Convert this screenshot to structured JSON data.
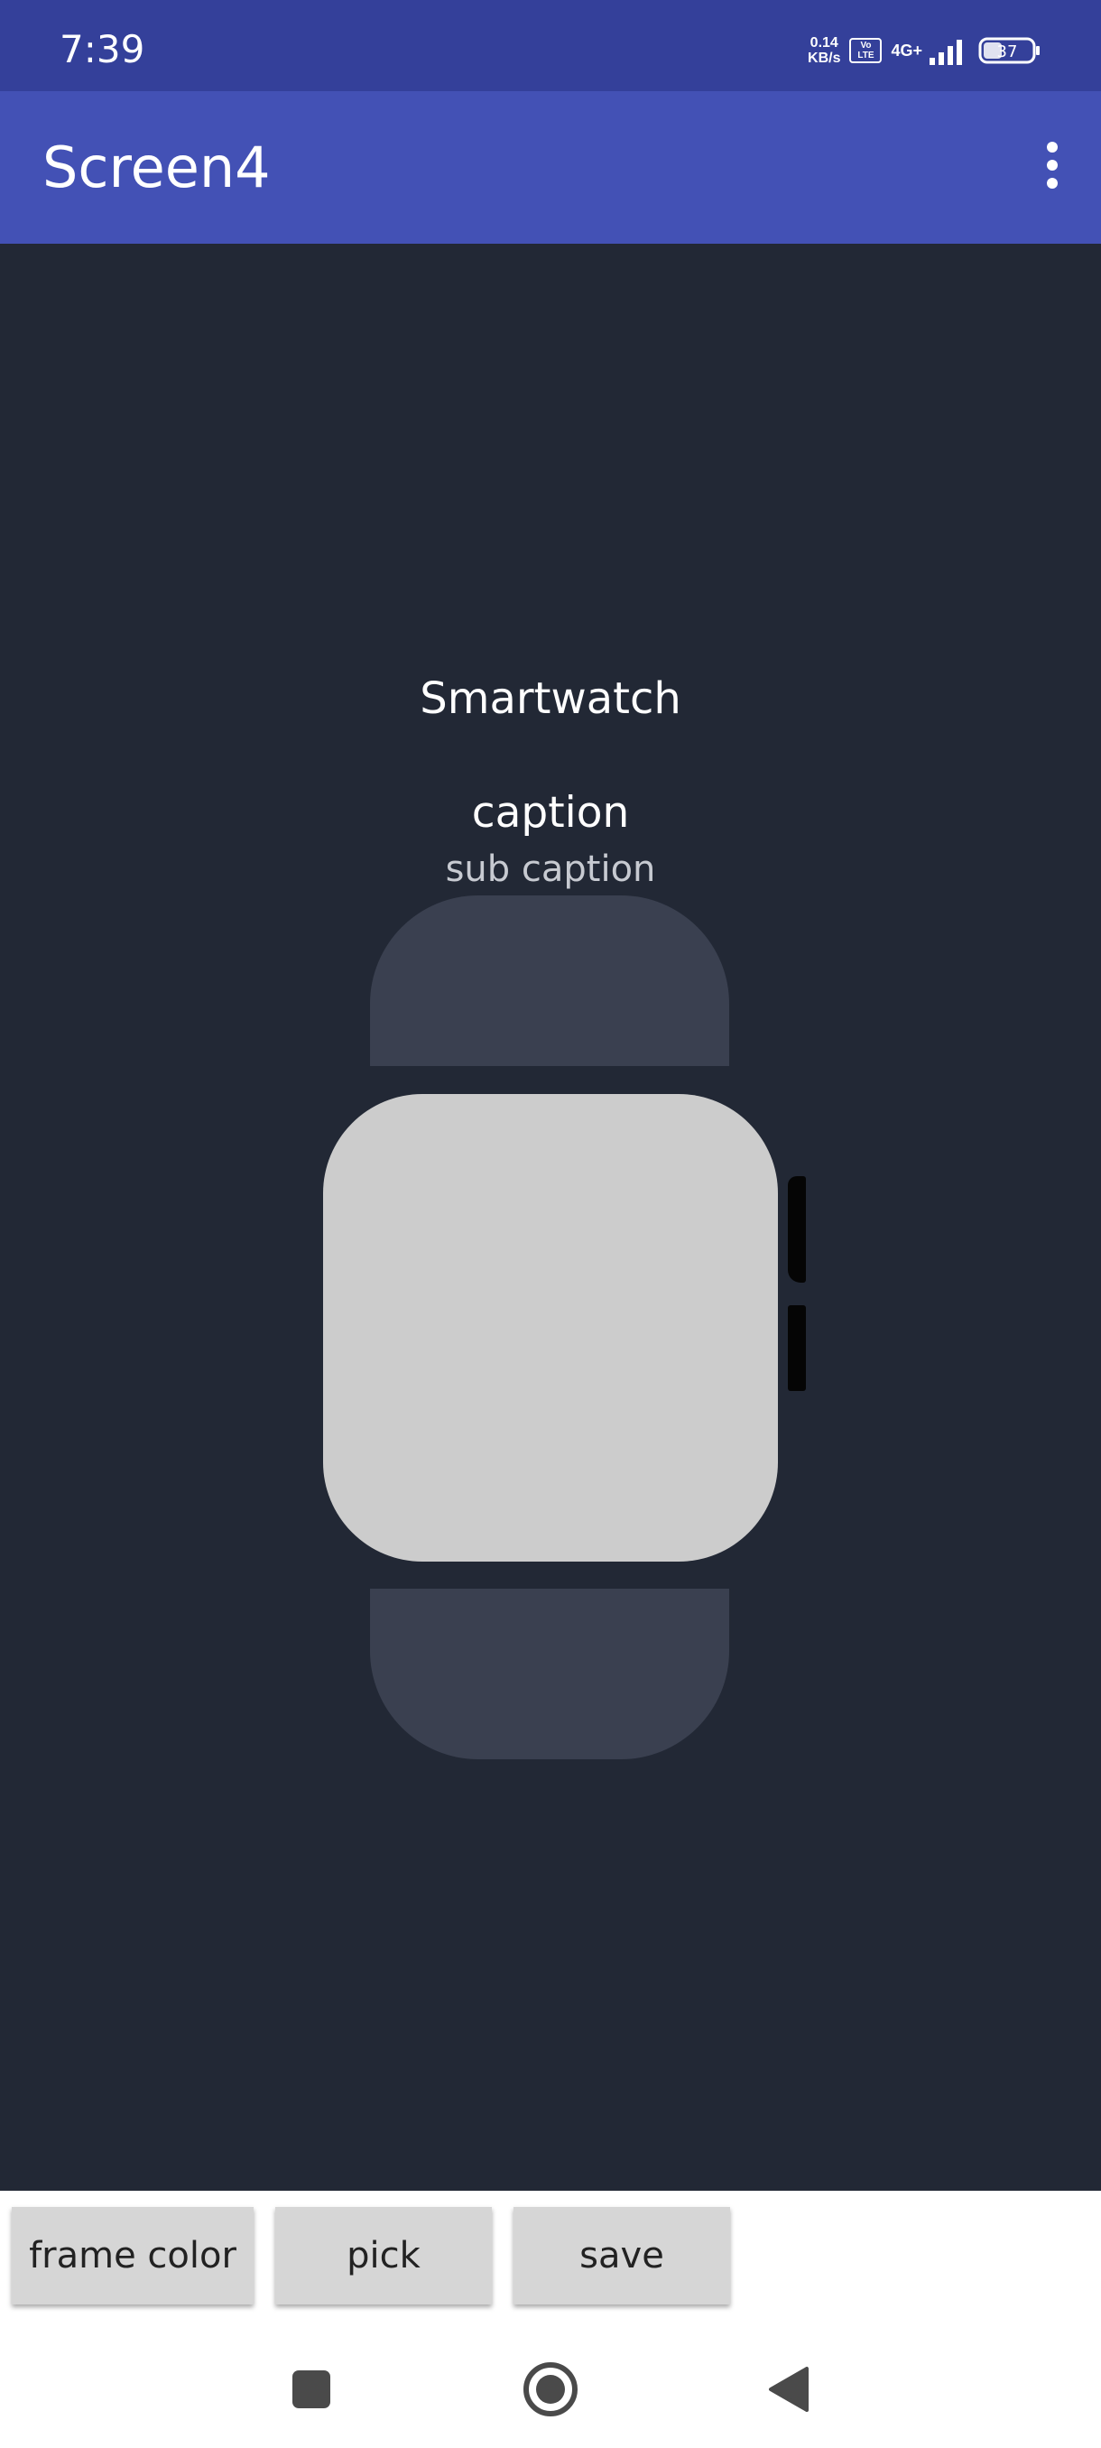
{
  "status_bar": {
    "time": "7:39",
    "net_speed_value": "0.14",
    "net_speed_unit": "KB/s",
    "volte_line1": "Vo",
    "volte_line2": "LTE",
    "network": "4G+",
    "battery": "37"
  },
  "app_bar": {
    "title": "Screen4",
    "menu_icon": "more-vert-icon"
  },
  "main": {
    "title": "Smartwatch",
    "caption": "caption",
    "sub_caption": "sub caption"
  },
  "buttons": {
    "frame_color": "frame color",
    "pick": "pick",
    "save": "save"
  },
  "nav": {
    "recents_icon": "square-icon",
    "home_icon": "circle-icon",
    "back_icon": "triangle-back-icon"
  },
  "colors": {
    "status_bar": "#34409a",
    "app_bar": "#4351b5",
    "background": "#222835",
    "strap": "#3a4050",
    "watch_face": "#cccccc",
    "button": "#d6d6d6"
  }
}
